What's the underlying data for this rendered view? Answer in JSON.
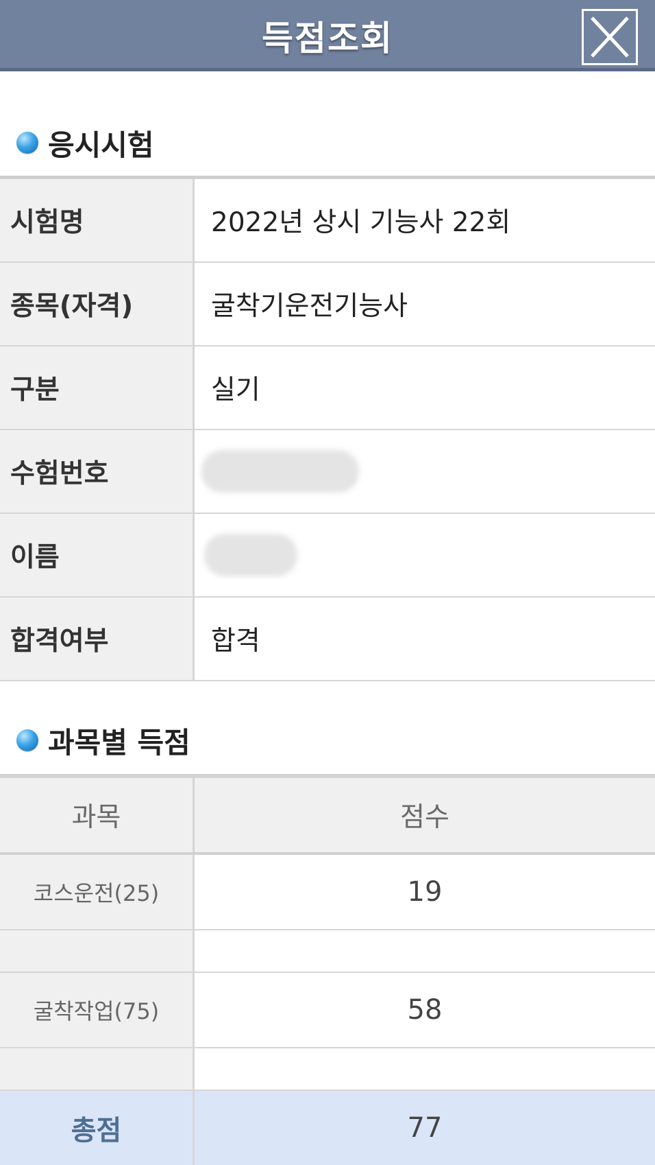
{
  "header": {
    "title": "득점조회",
    "close_icon": "close-icon"
  },
  "exam_section": {
    "heading": "응시시험",
    "rows": [
      {
        "label": "시험명",
        "value": "2022년 상시 기능사 22회"
      },
      {
        "label": "종목(자격)",
        "value": "굴착기운전기능사"
      },
      {
        "label": "구분",
        "value": "실기"
      },
      {
        "label": "수험번호",
        "value": ""
      },
      {
        "label": "이름",
        "value": ""
      },
      {
        "label": "합격여부",
        "value": "합격"
      }
    ]
  },
  "score_section": {
    "heading": "과목별 득점",
    "columns": [
      "과목",
      "점수"
    ],
    "subjects": [
      {
        "name": "코스운전(25)",
        "score": "19"
      },
      {
        "name": "굴착작업(75)",
        "score": "58"
      }
    ],
    "total_label": "총점",
    "total_value": "77"
  },
  "colors": {
    "header_bg": "#71829f",
    "label_bg": "#f0f0f0",
    "total_bg": "#dbe5f8",
    "total_label_color": "#4e6f93",
    "bullet": "#3aa3e6"
  }
}
